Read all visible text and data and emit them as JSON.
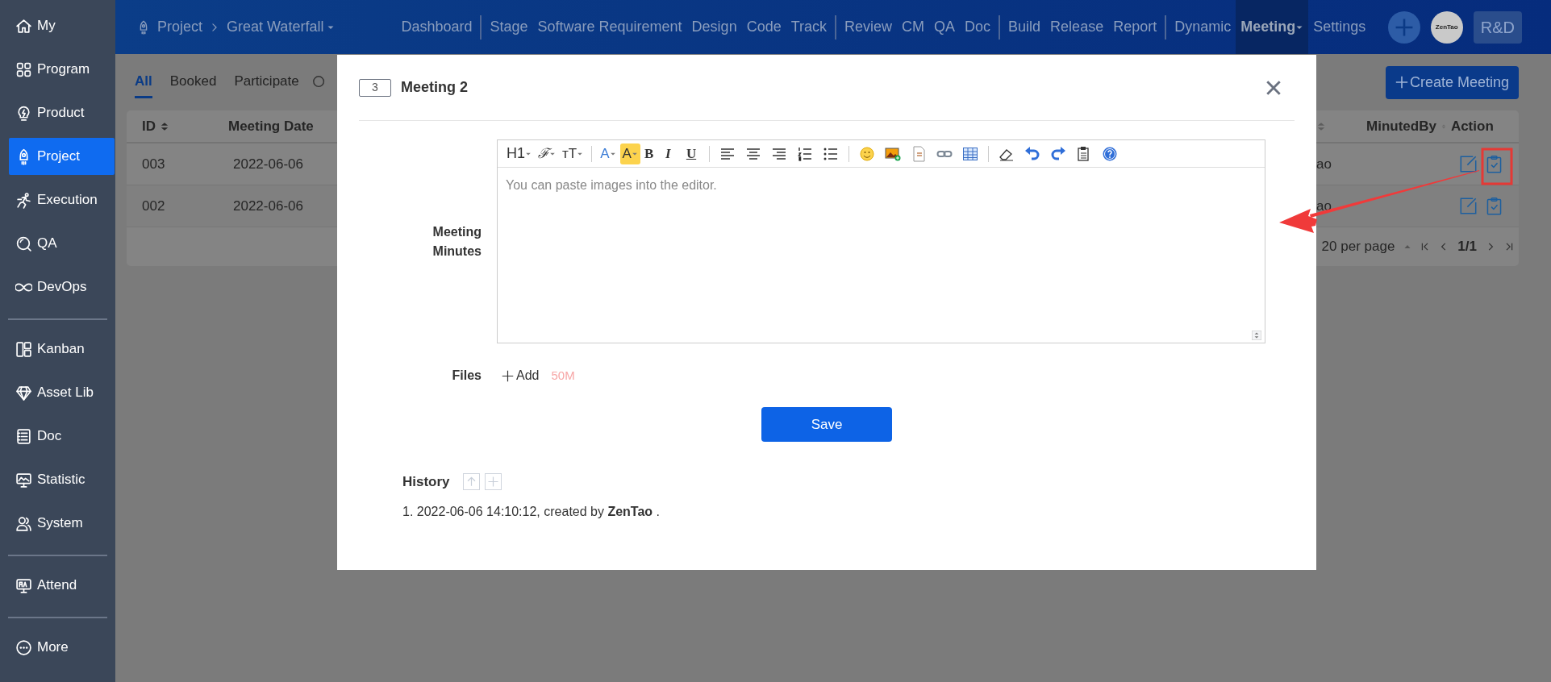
{
  "sidebar": {
    "groups": [
      [
        {
          "label": "My",
          "selected": false
        },
        {
          "label": "Program",
          "selected": false
        },
        {
          "label": "Product",
          "selected": false
        },
        {
          "label": "Project",
          "selected": true
        },
        {
          "label": "Execution",
          "selected": false
        },
        {
          "label": "QA",
          "selected": false
        },
        {
          "label": "DevOps",
          "selected": false
        }
      ],
      [
        {
          "label": "Kanban",
          "selected": false
        },
        {
          "label": "Asset Lib",
          "selected": false
        },
        {
          "label": "Doc",
          "selected": false
        },
        {
          "label": "Statistic",
          "selected": false
        },
        {
          "label": "System",
          "selected": false
        }
      ],
      [
        {
          "label": "Attend",
          "selected": false
        }
      ],
      [
        {
          "label": "More",
          "selected": false
        }
      ]
    ]
  },
  "topbar": {
    "breadcrumb": {
      "root": "Project",
      "current": "Great Waterfall"
    },
    "nav_groups": [
      [
        {
          "label": "Dashboard",
          "selected": false,
          "dropdown": false
        }
      ],
      [
        {
          "label": "Stage",
          "selected": false,
          "dropdown": false
        },
        {
          "label": "Software Requirement",
          "selected": false,
          "dropdown": false
        },
        {
          "label": "Design",
          "selected": false,
          "dropdown": false
        },
        {
          "label": "Code",
          "selected": false,
          "dropdown": false
        },
        {
          "label": "Track",
          "selected": false,
          "dropdown": false
        }
      ],
      [
        {
          "label": "Review",
          "selected": false,
          "dropdown": false
        },
        {
          "label": "CM",
          "selected": false,
          "dropdown": false
        },
        {
          "label": "QA",
          "selected": false,
          "dropdown": false
        },
        {
          "label": "Doc",
          "selected": false,
          "dropdown": false
        }
      ],
      [
        {
          "label": "Build",
          "selected": false,
          "dropdown": false
        },
        {
          "label": "Release",
          "selected": false,
          "dropdown": false
        },
        {
          "label": "Report",
          "selected": false,
          "dropdown": false
        }
      ],
      [
        {
          "label": "Dynamic",
          "selected": false,
          "dropdown": false
        },
        {
          "label": "Meeting",
          "selected": true,
          "dropdown": true
        },
        {
          "label": "Settings",
          "selected": false,
          "dropdown": false
        }
      ]
    ],
    "avatar": "ZenTao",
    "team": "R&D"
  },
  "tabs": [
    {
      "label": "All",
      "selected": true
    },
    {
      "label": "Booked",
      "selected": false
    },
    {
      "label": "Participate",
      "selected": false
    }
  ],
  "create_button": "Create Meeting",
  "table": {
    "columns_left": [
      "ID",
      "Meeting Date"
    ],
    "columns_right": [
      "MinutedBy",
      "Action"
    ],
    "rows": [
      {
        "id": "003",
        "date": "2022-06-06",
        "minuted_by": "ao"
      },
      {
        "id": "002",
        "date": "2022-06-06",
        "minuted_by": "ao"
      }
    ],
    "pagination": {
      "per_page": "20 per page",
      "page": "1/1"
    }
  },
  "modal": {
    "number": "3",
    "title": "Meeting 2",
    "minutes_label": "Meeting Minutes",
    "toolbar_text": [
      {
        "label": "H1"
      },
      {
        "label": "ℱ"
      },
      {
        "label": "ᴛT"
      },
      {
        "label": "A"
      },
      {
        "label": "A"
      },
      {
        "label": "B"
      },
      {
        "label": "I"
      },
      {
        "label": "U"
      }
    ],
    "placeholder": "You can paste images into the editor.",
    "files_label": "Files",
    "add": "Add",
    "size_limit": "50M",
    "save": "Save",
    "history": {
      "title": "History",
      "entries": [
        "1. 2022-06-06 14:10:12, created by **ZenTao** ."
      ]
    }
  }
}
